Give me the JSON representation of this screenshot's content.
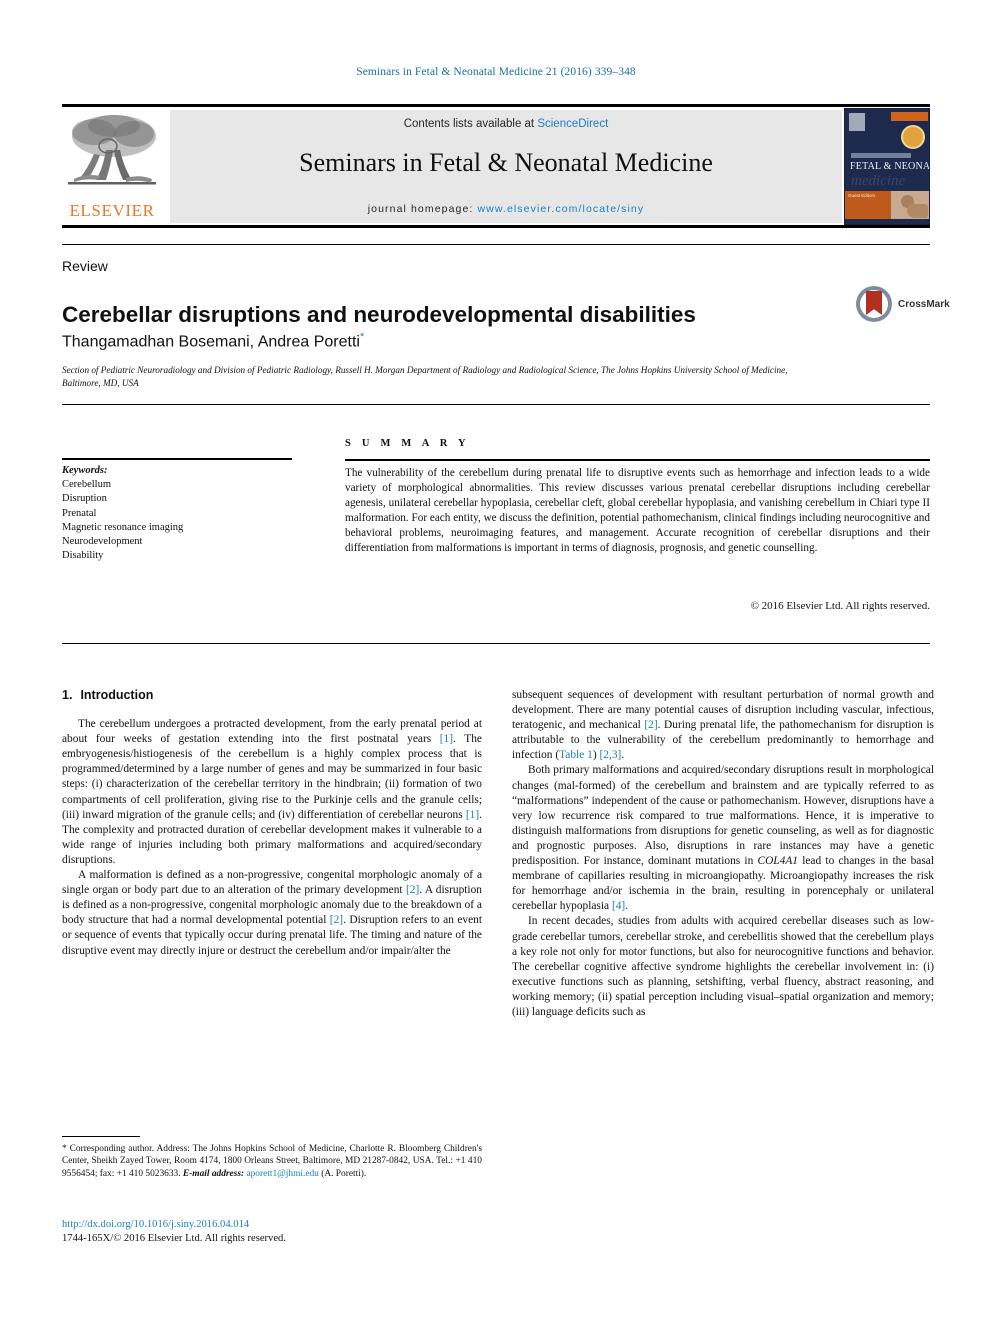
{
  "running_head": "Seminars in Fetal & Neonatal Medicine 21 (2016) 339–348",
  "masthead": {
    "publisher_name": "ELSEVIER",
    "contents_prefix": "Contents lists available at ",
    "contents_link": "ScienceDirect",
    "journal_title": "Seminars in Fetal & Neonatal Medicine",
    "homepage_prefix": "journal homepage: ",
    "homepage_url": "www.elsevier.com/locate/siny",
    "cover": {
      "line_small": "Seminars in",
      "line_main": "FETAL & NEONATAL",
      "line_script": "medicine",
      "badge_text": "Guest Editors"
    }
  },
  "article": {
    "doctype": "Review",
    "title": "Cerebellar disruptions and neurodevelopmental disabilities",
    "authors": "Thangamadhan Bosemani, Andrea Poretti",
    "author_footnote_marker": "*",
    "affiliation": "Section of Pediatric Neuroradiology and Division of Pediatric Radiology, Russell H. Morgan Department of Radiology and Radiological Science, The Johns Hopkins University School of Medicine, Baltimore, MD, USA",
    "crossmark_label": "CrossMark"
  },
  "keywords": {
    "heading": "Keywords:",
    "items": [
      "Cerebellum",
      "Disruption",
      "Prenatal",
      "Magnetic resonance imaging",
      "Neurodevelopment",
      "Disability"
    ]
  },
  "summary": {
    "heading": "S U M M A R Y",
    "body": "The vulnerability of the cerebellum during prenatal life to disruptive events such as hemorrhage and infection leads to a wide variety of morphological abnormalities. This review discusses various prenatal cerebellar disruptions including cerebellar agenesis, unilateral cerebellar hypoplasia, cerebellar cleft, global cerebellar hypoplasia, and vanishing cerebellum in Chiari type II malformation. For each entity, we discuss the definition, potential pathomechanism, clinical findings including neurocognitive and behavioral problems, neuroimaging features, and management. Accurate recognition of cerebellar disruptions and their differentiation from malformations is important in terms of diagnosis, prognosis, and genetic counselling.",
    "copyright": "© 2016 Elsevier Ltd. All rights reserved."
  },
  "body": {
    "section_number": "1.",
    "section_title": "Introduction",
    "left_paragraphs": [
      {
        "segments": [
          {
            "t": "The cerebellum undergoes a protracted development, from the early prenatal period at about four weeks of gestation extending into the first postnatal years "
          },
          {
            "t": "[1]",
            "k": "ref"
          },
          {
            "t": ". The embryogenesis/histiogenesis of the cerebellum is a highly complex process that is programmed/determined by a large number of genes and may be summarized in four basic steps: (i) characterization of the cerebellar territory in the hindbrain; (ii) formation of two compartments of cell proliferation, giving rise to the Purkinje cells and the granule cells; (iii) inward migration of the granule cells; and (iv) differentiation of cerebellar neurons "
          },
          {
            "t": "[1]",
            "k": "ref"
          },
          {
            "t": ". The complexity and protracted duration of cerebellar development makes it vulnerable to a wide range of injuries including both primary malformations and acquired/secondary disruptions."
          }
        ]
      },
      {
        "segments": [
          {
            "t": "A malformation is defined as a non-progressive, congenital morphologic anomaly of a single organ or body part due to an alteration of the primary development "
          },
          {
            "t": "[2]",
            "k": "ref"
          },
          {
            "t": ". A disruption is defined as a non-progressive, congenital morphologic anomaly due to the breakdown of a body structure that had a normal developmental potential "
          },
          {
            "t": "[2]",
            "k": "ref"
          },
          {
            "t": ". Disruption refers to an event or sequence of events that typically occur during prenatal life. The timing and nature of the disruptive event may directly injure or destruct the cerebellum and/or impair/alter the"
          }
        ]
      }
    ],
    "right_paragraphs": [
      {
        "no_indent": true,
        "segments": [
          {
            "t": "subsequent sequences of development with resultant perturbation of normal growth and development. There are many potential causes of disruption including vascular, infectious, teratogenic, and mechanical "
          },
          {
            "t": "[2]",
            "k": "ref"
          },
          {
            "t": ". During prenatal life, the pathomechanism for disruption is attributable to the vulnerability of the cerebellum predominantly to hemorrhage and infection ("
          },
          {
            "t": "Table 1",
            "k": "ref"
          },
          {
            "t": ") "
          },
          {
            "t": "[2,3]",
            "k": "ref"
          },
          {
            "t": "."
          }
        ]
      },
      {
        "segments": [
          {
            "t": "Both primary malformations and acquired/secondary disruptions result in morphological changes (mal-formed) of the cerebellum and brainstem and are typically referred to as “malformations” independent of the cause or pathomechanism. However, disruptions have a very low recurrence risk compared to true malformations. Hence, it is imperative to distinguish malformations from disruptions for genetic counseling, as well as for diagnostic and prognostic purposes. Also, disruptions in rare instances may have a genetic predisposition. For instance, dominant mutations in "
          },
          {
            "t": "COL4A1",
            "k": "italic"
          },
          {
            "t": " lead to changes in the basal membrane of capillaries resulting in microangiopathy. Microangiopathy increases the risk for hemorrhage and/or ischemia in the brain, resulting in porencephaly or unilateral cerebellar hypoplasia "
          },
          {
            "t": "[4]",
            "k": "ref"
          },
          {
            "t": "."
          }
        ]
      },
      {
        "segments": [
          {
            "t": "In recent decades, studies from adults with acquired cerebellar diseases such as low-grade cerebellar tumors, cerebellar stroke, and cerebellitis showed that the cerebellum plays a key role not only for motor functions, but also for neurocognitive functions and behavior. The cerebellar cognitive affective syndrome highlights the cerebellar involvement in: (i) executive functions such as planning, setshifting, verbal fluency, abstract reasoning, and working memory; (ii) spatial perception including visual–spatial organization and memory; (iii) language deficits such as"
          }
        ]
      }
    ]
  },
  "footer": {
    "corresponding_marker": "*",
    "corresponding_text": " Corresponding author. Address: The Johns Hopkins School of Medicine, Charlotte R. Bloomberg Children's Center, Sheikh Zayed Tower, Room 4174, 1800 Orleans Street, Baltimore, MD 21287-0842, USA. Tel.: +1 410 9556454; fax: +1 410 5023633.",
    "email_label": "E-mail address:",
    "email": "aporett1@jhmi.edu",
    "email_suffix": " (A. Poretti).",
    "doi_url": "http://dx.doi.org/10.1016/j.siny.2016.04.014",
    "issn_line": "1744-165X/© 2016 Elsevier Ltd. All rights reserved."
  },
  "colors": {
    "link_blue": "#1a7fc1",
    "running_head_blue": "#1a6fa3",
    "elsevier_orange": "#e87722",
    "band_gray": "#e7e7e7"
  }
}
